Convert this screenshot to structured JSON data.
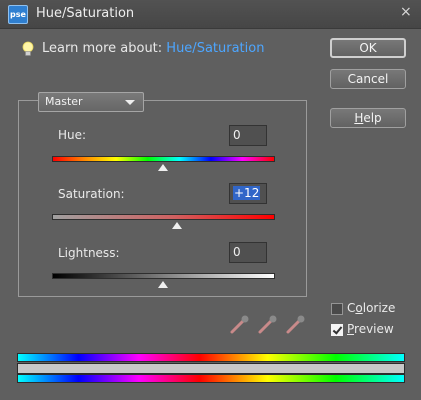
{
  "window": {
    "title": "Hue/Saturation",
    "app_icon_label": "pse",
    "close_glyph": "×"
  },
  "help_line": {
    "prefix": "Learn more about: ",
    "link": "Hue/Saturation",
    "icon": "lightbulb-icon"
  },
  "buttons": {
    "ok": "OK",
    "cancel": "Cancel",
    "help_mnemonic": "H",
    "help_rest": "elp"
  },
  "channel": {
    "selected": "Master"
  },
  "hue": {
    "label": "Hue:",
    "value": "0",
    "position": 0.5
  },
  "saturation": {
    "label": "Saturation:",
    "value": "+12",
    "position": 0.56
  },
  "lightness": {
    "label": "Lightness:",
    "value": "0",
    "position": 0.5
  },
  "eyedroppers": [
    "eyedropper-icon",
    "eyedropper-plus-icon",
    "eyedropper-minus-icon"
  ],
  "options": {
    "colorize_mnemonic": "o",
    "colorize_before": "C",
    "colorize_after": "lorize",
    "colorize_checked": false,
    "preview_mnemonic": "P",
    "preview_rest": "review",
    "preview_checked": true
  },
  "colors": {
    "dialog_bg": "#5f5f5f",
    "link": "#4da6ff",
    "selection": "#3166c8"
  }
}
